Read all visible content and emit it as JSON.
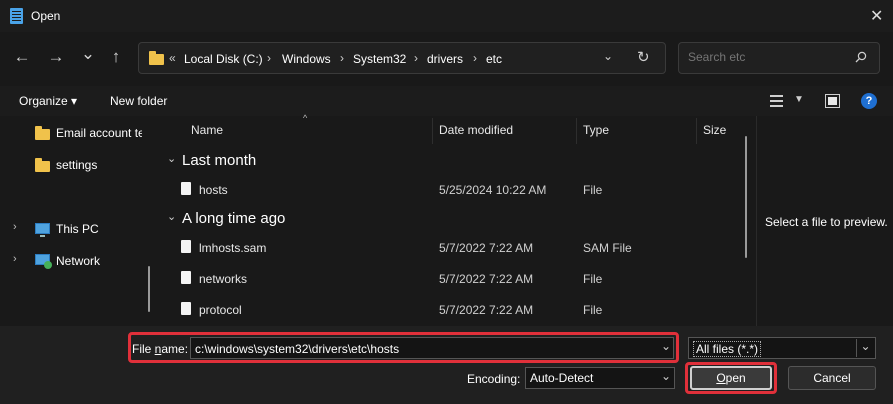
{
  "window": {
    "title": "Open",
    "close_glyph": "✕"
  },
  "nav": {
    "back_glyph": "←",
    "forward_glyph": "→",
    "recent_glyph": "⌄",
    "up_glyph": "↑"
  },
  "address_bar": {
    "overflow_glyph": "«",
    "crumbs": [
      "Local Disk (C:)",
      "Windows",
      "System32",
      "drivers",
      "etc"
    ],
    "separator": "›",
    "dropdown_glyph": "⌄",
    "refresh_glyph": "↻"
  },
  "search": {
    "placeholder": "Search etc"
  },
  "toolbar": {
    "organize_label": "Organize ▾",
    "new_folder_label": "New folder",
    "help_glyph": "?"
  },
  "sidebar": {
    "items": [
      {
        "label": "Email account te",
        "icon": "folder-icon"
      },
      {
        "label": "settings",
        "icon": "folder-icon"
      },
      {
        "label": "This PC",
        "icon": "computer-icon",
        "expander": "›"
      },
      {
        "label": "Network",
        "icon": "network-icon",
        "expander": "›"
      }
    ]
  },
  "file_list": {
    "columns": [
      "Name",
      "Date modified",
      "Type",
      "Size"
    ],
    "sort_glyph": "^",
    "groups": [
      {
        "label": "Last month",
        "chevron": "⌄",
        "rows": [
          {
            "name": "hosts",
            "date": "5/25/2024 10:22 AM",
            "type": "File"
          }
        ]
      },
      {
        "label": "A long time ago",
        "chevron": "⌄",
        "rows": [
          {
            "name": "lmhosts.sam",
            "date": "5/7/2022 7:22 AM",
            "type": "SAM File"
          },
          {
            "name": "networks",
            "date": "5/7/2022 7:22 AM",
            "type": "File"
          },
          {
            "name": "protocol",
            "date": "5/7/2022 7:22 AM",
            "type": "File"
          }
        ]
      }
    ]
  },
  "preview": {
    "text": "Select a file to preview."
  },
  "footer": {
    "file_name_label_pre": "File ",
    "file_name_label_key": "n",
    "file_name_label_post": "ame:",
    "file_name_value": "c:\\windows\\system32\\drivers\\etc\\hosts",
    "filter_value": "All files  (*.*)",
    "encoding_label": "Encoding:",
    "encoding_value": "Auto-Detect",
    "open_label_key": "O",
    "open_label_rest": "pen",
    "cancel_label": "Cancel",
    "dropdown_glyph": "⌄"
  },
  "colors": {
    "highlight": "#e0303a",
    "folder": "#f0c24b",
    "help_accent": "#1f6fd1"
  }
}
